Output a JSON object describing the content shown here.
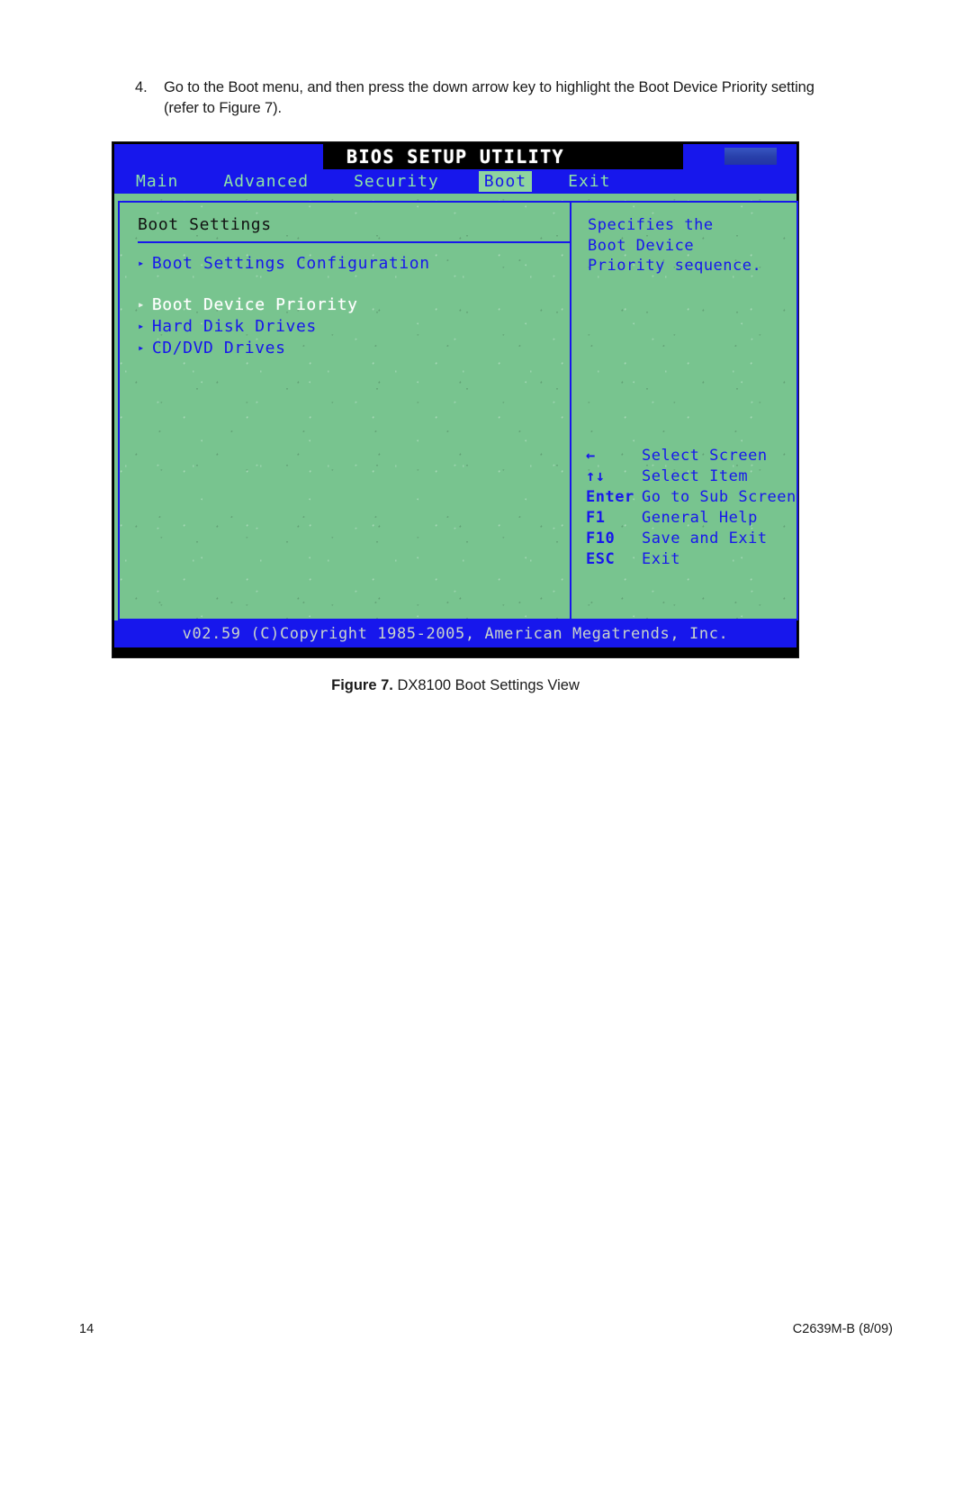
{
  "document": {
    "step": {
      "number": "4.",
      "text": "Go to the Boot menu, and then press the down arrow key to highlight the Boot Device Priority setting (refer to Figure 7)."
    },
    "figure_caption_label": "Figure 7.",
    "figure_caption_text": " DX8100 Boot Settings View",
    "page_number": "14",
    "doc_code": "C2639M-B (8/09)"
  },
  "bios": {
    "title": "BIOS SETUP UTILITY",
    "menu": [
      {
        "label": "Main",
        "active": false
      },
      {
        "label": "Advanced",
        "active": false
      },
      {
        "label": "Security",
        "active": false
      },
      {
        "label": "Boot",
        "active": true
      },
      {
        "label": "Exit",
        "active": false
      }
    ],
    "left_panel": {
      "heading": "Boot Settings",
      "items": [
        {
          "label": "Boot Settings Configuration",
          "selected": false,
          "marker": "▸"
        },
        {
          "label": "Boot Device Priority",
          "selected": true,
          "marker": "▸"
        },
        {
          "label": "Hard Disk Drives",
          "selected": false,
          "marker": "▸"
        },
        {
          "label": "CD/DVD Drives",
          "selected": false,
          "marker": "▸"
        }
      ]
    },
    "right_panel": {
      "help": "Specifies the\nBoot Device\nPriority sequence.",
      "keys": [
        {
          "key": "←",
          "desc": "Select Screen"
        },
        {
          "key": "↑↓",
          "desc": "Select Item"
        },
        {
          "key": "Enter",
          "desc": "Go to Sub Screen"
        },
        {
          "key": "F1",
          "desc": "General Help"
        },
        {
          "key": "F10",
          "desc": "Save and Exit"
        },
        {
          "key": "ESC",
          "desc": "Exit"
        }
      ]
    },
    "footer": "v02.59 (C)Copyright 1985-2005, American Megatrends, Inc.",
    "colors": {
      "screen_bg": "#79c490",
      "accent_blue": "#1717e8",
      "menu_text": "#8fe3a8",
      "selected_text": "#ffffff",
      "title_bar_bg": "#000000",
      "footer_text": "#c9d4cb"
    }
  }
}
